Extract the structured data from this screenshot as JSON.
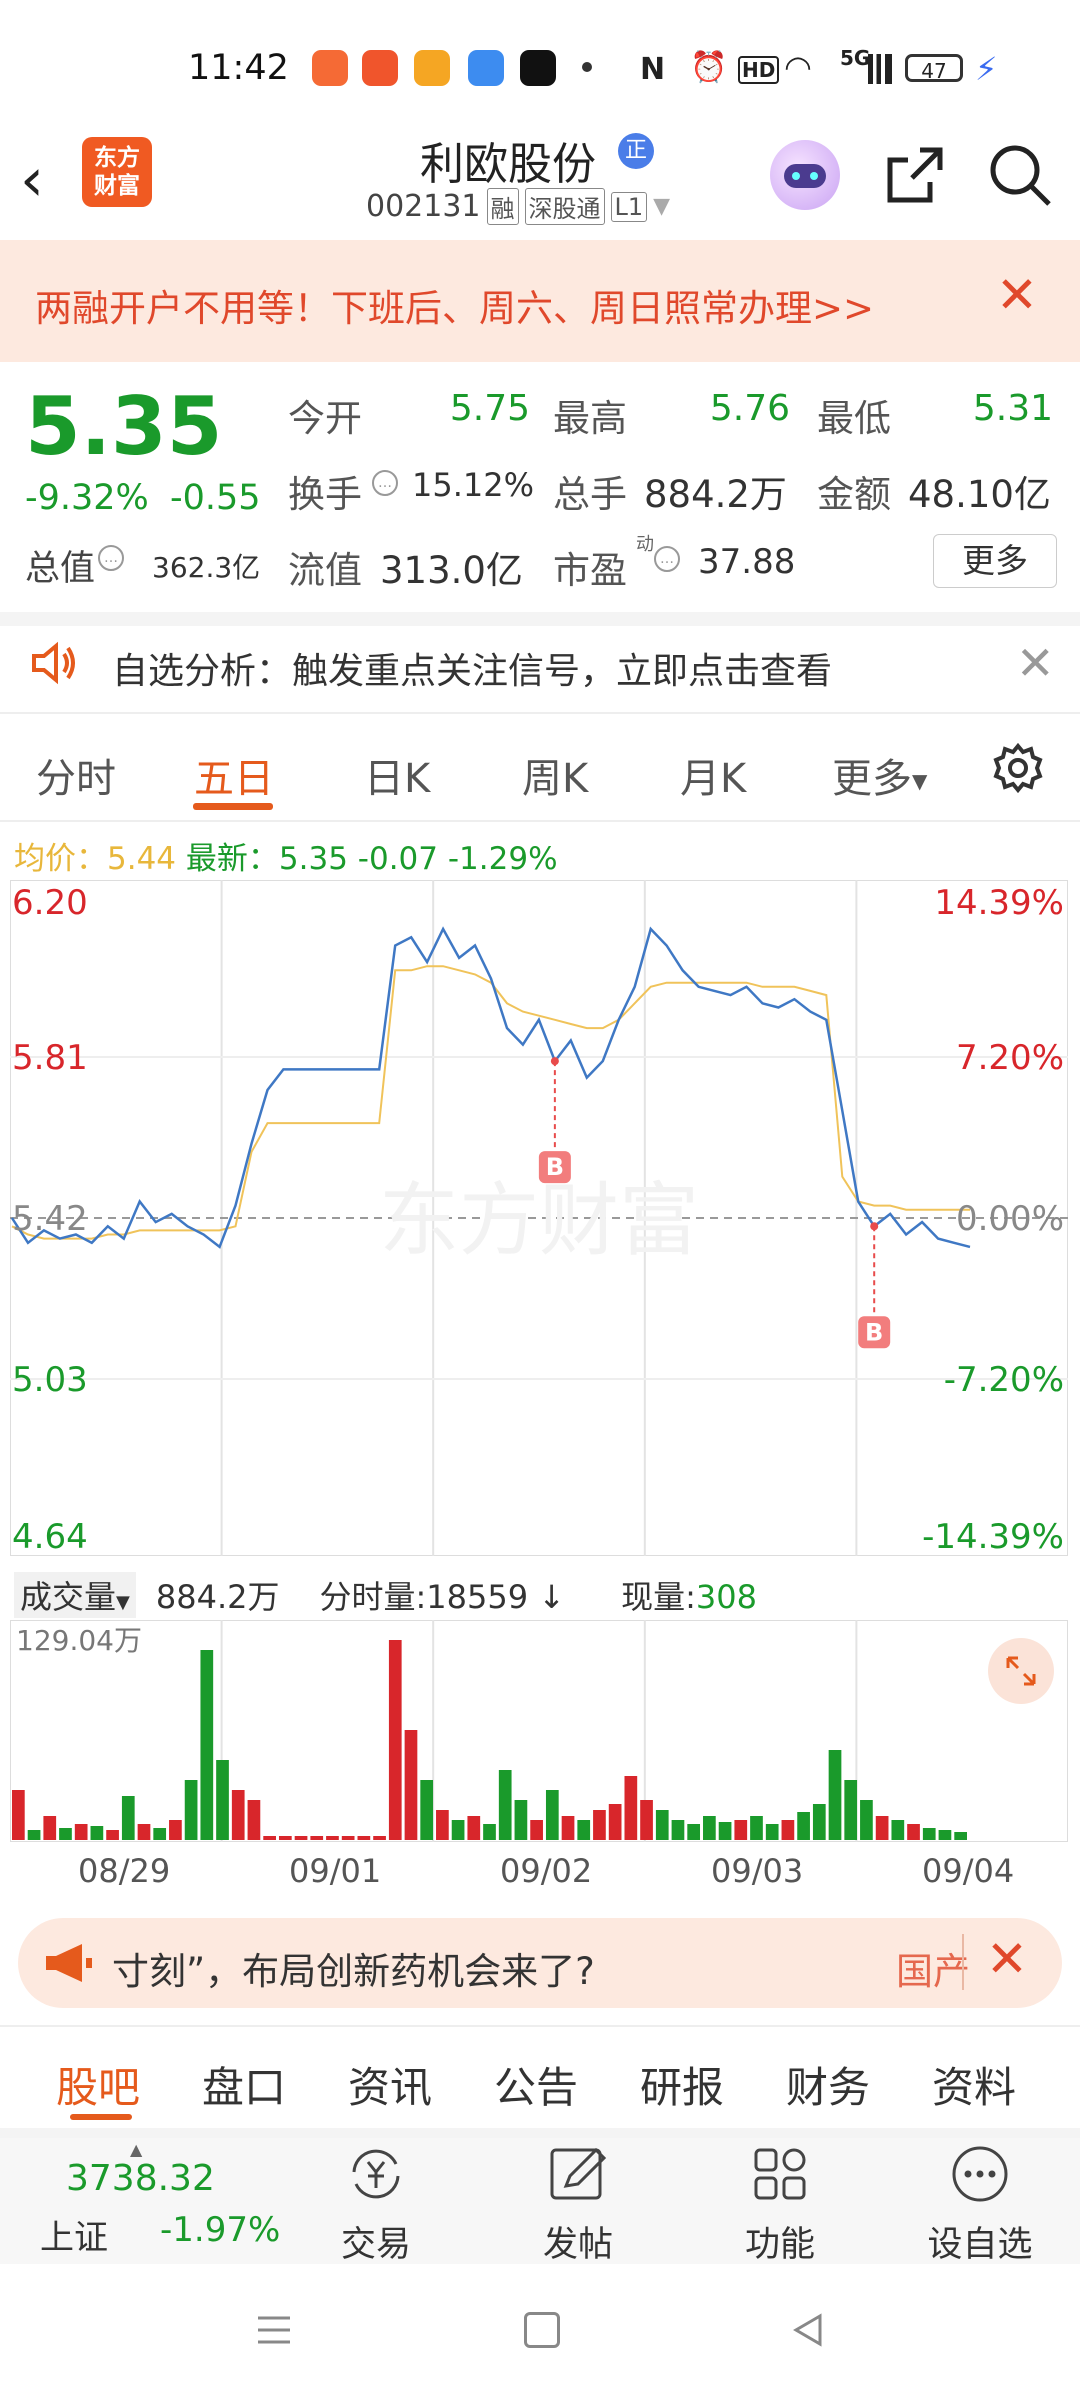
{
  "status_bar": {
    "time": "11:42",
    "battery": "47",
    "network": "5G"
  },
  "header": {
    "logo_text": "东方\n财富",
    "stock_name": "利欧股份",
    "rzq_badge": "正",
    "code": "002131",
    "tags": [
      "融",
      "深股通",
      "L1"
    ]
  },
  "banner": {
    "text": "两融开户不用等！下班后、周六、周日照常办理>>"
  },
  "quote": {
    "price": "5.35",
    "change_pct": "-9.32%",
    "change": "-0.55",
    "total_value_label": "总值",
    "total_value": "362.3亿",
    "fields": [
      {
        "label": "今开",
        "value": "5.75",
        "color": "#1a9a2b"
      },
      {
        "label": "最高",
        "value": "5.76",
        "color": "#1a9a2b"
      },
      {
        "label": "最低",
        "value": "5.31",
        "color": "#1a9a2b"
      },
      {
        "label": "换手",
        "value": "15.12%",
        "color": "#333333"
      },
      {
        "label": "总手",
        "value": "884.2万",
        "color": "#333333"
      },
      {
        "label": "金额",
        "value": "48.10亿",
        "color": "#333333"
      },
      {
        "label": "流值",
        "value": "313.0亿",
        "color": "#333333"
      },
      {
        "label": "市盈",
        "value": "37.88",
        "color": "#333333"
      }
    ],
    "pe_sup": "动",
    "more_label": "更多"
  },
  "analysis": {
    "text": "自选分析：触发重点关注信号，立即点击查看"
  },
  "chart_tabs": [
    "分时",
    "五日",
    "日K",
    "周K",
    "月K",
    "更多"
  ],
  "avg_line": {
    "avg_label": "均价：",
    "avg_value": "5.44",
    "latest_label": "最新：",
    "latest_value": "5.35",
    "latest_change": "-0.07",
    "latest_pct": "-1.29%"
  },
  "chart_data": {
    "type": "line",
    "title": "",
    "x_labels": [
      "08/29",
      "09/01",
      "09/02",
      "09/03",
      "09/04"
    ],
    "y_left_ticks": [
      "6.20",
      "5.81",
      "5.42",
      "5.03",
      "4.64"
    ],
    "y_right_ticks": [
      "14.39%",
      "7.20%",
      "0.00%",
      "-7.20%",
      "-14.39%"
    ],
    "ylim": [
      4.64,
      6.2
    ],
    "base_price": 5.42,
    "series": [
      {
        "name": "price",
        "values": [
          5.42,
          5.36,
          5.39,
          5.37,
          5.38,
          5.36,
          5.4,
          5.37,
          5.46,
          5.41,
          5.43,
          5.4,
          5.38,
          5.35,
          5.45,
          5.6,
          5.73,
          5.78,
          5.78,
          5.78,
          5.78,
          5.78,
          5.78,
          5.78,
          6.08,
          6.1,
          6.04,
          6.12,
          6.05,
          6.08,
          6.0,
          5.88,
          5.84,
          5.9,
          5.8,
          5.85,
          5.76,
          5.8,
          5.9,
          5.98,
          6.12,
          6.08,
          6.02,
          5.98,
          5.97,
          5.96,
          5.98,
          5.94,
          5.93,
          5.95,
          5.92,
          5.9,
          5.68,
          5.46,
          5.4,
          5.43,
          5.38,
          5.41,
          5.37,
          5.36,
          5.35
        ]
      },
      {
        "name": "avg",
        "values": [
          5.4,
          5.38,
          5.37,
          5.37,
          5.37,
          5.37,
          5.38,
          5.38,
          5.39,
          5.39,
          5.39,
          5.39,
          5.39,
          5.39,
          5.4,
          5.58,
          5.65,
          5.65,
          5.65,
          5.65,
          5.65,
          5.65,
          5.65,
          5.65,
          6.02,
          6.02,
          6.03,
          6.03,
          6.02,
          6.01,
          5.99,
          5.94,
          5.92,
          5.91,
          5.9,
          5.89,
          5.88,
          5.88,
          5.9,
          5.94,
          5.98,
          5.99,
          5.99,
          5.99,
          5.99,
          5.99,
          5.99,
          5.98,
          5.98,
          5.98,
          5.97,
          5.96,
          5.52,
          5.46,
          5.45,
          5.45,
          5.44,
          5.44,
          5.44,
          5.44,
          5.44
        ]
      }
    ],
    "markers": [
      {
        "label": "B",
        "at_index": 34
      },
      {
        "label": "B",
        "at_index": 54
      }
    ],
    "volume": {
      "max_label": "129.04万",
      "values": [
        0.25,
        0.05,
        0.12,
        0.06,
        0.08,
        0.07,
        0.05,
        0.22,
        0.08,
        0.06,
        0.1,
        0.3,
        0.95,
        0.4,
        0.25,
        0.2,
        0.02,
        0.02,
        0.02,
        0.02,
        0.02,
        0.02,
        0.02,
        0.02,
        1.0,
        0.55,
        0.3,
        0.15,
        0.1,
        0.12,
        0.08,
        0.35,
        0.2,
        0.1,
        0.25,
        0.12,
        0.1,
        0.15,
        0.18,
        0.32,
        0.2,
        0.15,
        0.1,
        0.08,
        0.12,
        0.09,
        0.1,
        0.12,
        0.08,
        0.1,
        0.14,
        0.18,
        0.45,
        0.3,
        0.2,
        0.12,
        0.1,
        0.08,
        0.06,
        0.05,
        0.04
      ]
    }
  },
  "volume_header": {
    "dropdown_label": "成交量",
    "volume": "884.2万",
    "tick_label": "分时量:",
    "tick_value": "18559",
    "now_label": "现量:",
    "now_value": "308"
  },
  "ticker": {
    "text": "寸刻”，布局创新药机会来了?",
    "tag": "国产"
  },
  "bottom_tabs": [
    "股吧",
    "盘口",
    "资讯",
    "公告",
    "研报",
    "财务",
    "资料"
  ],
  "bottom_nav": {
    "index_value": "3738.32",
    "index_name": "上证",
    "index_pct": "-1.97%",
    "items": [
      {
        "label": "交易",
        "icon": "yen-refresh-icon"
      },
      {
        "label": "发帖",
        "icon": "edit-icon"
      },
      {
        "label": "功能",
        "icon": "grid-icon"
      },
      {
        "label": "设自选",
        "icon": "more-circle-icon"
      }
    ]
  }
}
